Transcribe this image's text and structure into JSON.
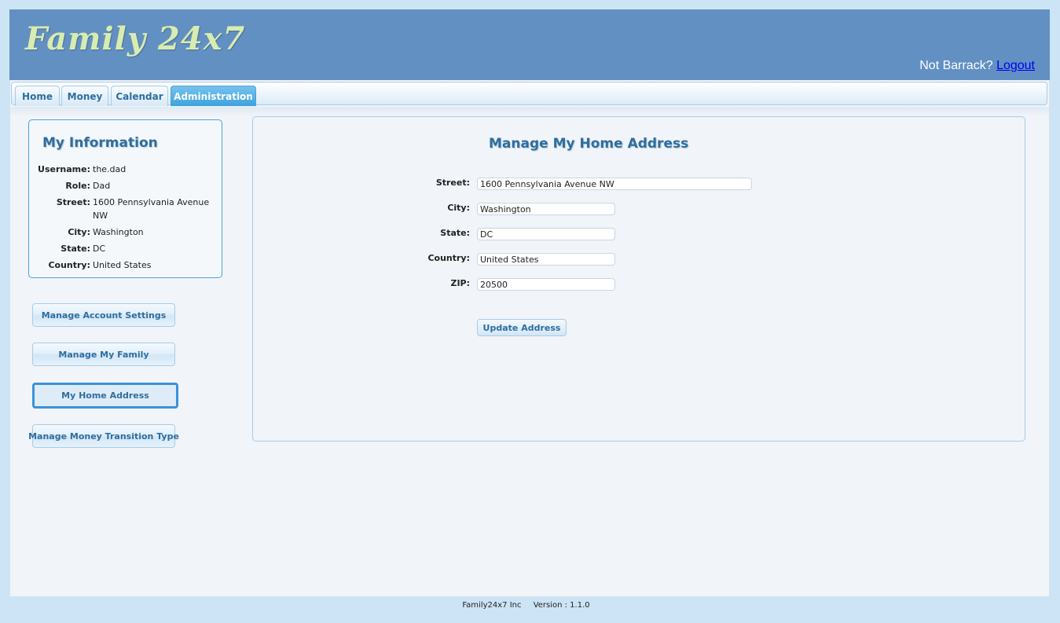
{
  "header": {
    "logo": "Family 24x7",
    "user_prompt": "Not Barrack?",
    "logout_label": "Logout"
  },
  "tabs": [
    {
      "label": "Home"
    },
    {
      "label": "Money"
    },
    {
      "label": "Calendar"
    },
    {
      "label": "Administration",
      "active": true
    }
  ],
  "info": {
    "title": "My Information",
    "rows": [
      {
        "key": "Username:",
        "value": "the.dad"
      },
      {
        "key": "Role:",
        "value": "Dad"
      },
      {
        "key": "Street:",
        "value": "1600 Pennsylvania Avenue NW"
      },
      {
        "key": "City:",
        "value": "Washington"
      },
      {
        "key": "State:",
        "value": "DC"
      },
      {
        "key": "Country:",
        "value": "United States"
      }
    ]
  },
  "sidebar": {
    "buttons": [
      {
        "label": "Manage Account Settings"
      },
      {
        "label": "Manage My Family"
      },
      {
        "label": "My Home Address",
        "active": true
      },
      {
        "label": "Manage Money Transition Type"
      }
    ]
  },
  "form": {
    "title": "Manage My Home Address",
    "fields": [
      {
        "label": "Street:",
        "value": "1600 Pennsylvania Avenue NW"
      },
      {
        "label": "City:",
        "value": "Washington"
      },
      {
        "label": "State:",
        "value": "DC"
      },
      {
        "label": "Country:",
        "value": "United States"
      },
      {
        "label": "ZIP:",
        "value": "20500"
      }
    ],
    "submit_label": "Update Address"
  },
  "footer": {
    "company": "Family24x7 Inc",
    "version": "Version : 1.1.0"
  },
  "colors": {
    "background": "#cde4f6",
    "header": "#6290c3",
    "accent": "#2e6e9e",
    "active_tab": "#3ea2dd"
  }
}
